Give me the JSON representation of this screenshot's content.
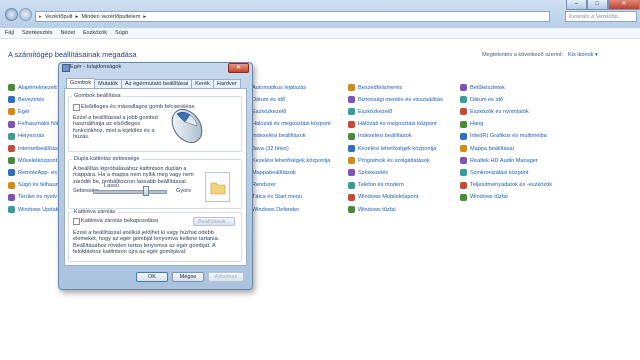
{
  "address": {
    "crumbs": [
      "Vezérlőpult",
      "Minden vezérlőpultelem"
    ],
    "search_placeholder": "Keresés a Vezérlőp..."
  },
  "window_controls": [
    "–",
    "□",
    "✕"
  ],
  "menu": [
    "Fájl",
    "Szerkesztés",
    "Nézet",
    "Eszközök",
    "Súgó"
  ],
  "page": {
    "title": "A számítógép beállításainak megadása",
    "view_label": "Megtekintés a következő szerint:",
    "view_value": "Kis ikonok ▾"
  },
  "items": {
    "col1": [
      "Alapértelmezett programok",
      "Bevezetés",
      "Egér",
      "Felhasználói fiókok",
      "Helyesírás",
      "Internetbeállítások",
      "Műveletközpont",
      "RemoteApp- és asztali kapcsolatok",
      "Súgó és felhasználói támogatás",
      "Terület és nyelv",
      "Windows Update"
    ],
    "col2": [
      "Automatikus lejátszás",
      "Dátum és idő",
      "Eszközkezelő",
      "Hálózati és megosztási központ",
      "Indexelési beállítások",
      "Java (32 bites)",
      "Kezelési lehetőségek központja",
      "Mappabeállítások",
      "Rendszer",
      "Tálca és Start menü",
      "Windows Defender"
    ],
    "col3": [
      "Beszédfelismerés",
      "Biztonsági mentés és visszaállítás",
      "Eszközkezelő",
      "Hálózati és megosztási központ",
      "Indexelési beállítások",
      "Kezelési lehetőségek központja",
      "Programok és szolgáltatások",
      "Színkezelés",
      "Telefon és modem",
      "Windows Mobileközpont",
      "Windows tűzfal"
    ],
    "col4": [
      "Betűkészletek",
      "Dátum és idő",
      "Eszközök és nyomtatók",
      "Hang",
      "Intel(R) Grafikus és multimédia",
      "Mappa beállításai",
      "Realtek HD Audio Manager",
      "Szinkronizálási központ",
      "Teljesítményadatok és -eszközök",
      "Windows tűzfal"
    ]
  },
  "icon_colors": [
    "#4b8a3b",
    "#2f6fc4",
    "#d28a1d",
    "#7a56b6",
    "#3b9a9a",
    "#c44b3a"
  ],
  "dialog": {
    "title": "Egér - tulajdonságok",
    "tabs": [
      "Gombok",
      "Mutatók",
      "Az egérmutató beállításai",
      "Kerék",
      "Hardver"
    ],
    "group1": {
      "title": "Gombok beállítása",
      "checkbox_label": "Elsődleges és másodlagos gomb felcserélése",
      "description": "Ezzel a beállítással a jobb gombot használhatja az elsődleges funkciókhoz, mint a kijelölés és a húzás."
    },
    "group2": {
      "title": "Dupla kattintás sebessége",
      "description": "A beállítás kipróbálásához kattintson duplán a mappára. Ha a mappa nem nyílik meg vagy nem záródik be, próbálkozzon lassabb beállítással.",
      "speed_label": "Sebesség:",
      "slow": "Lassú",
      "fast": "Gyors",
      "slider_value": 0.72
    },
    "group3": {
      "title": "Kattintva zárolás",
      "checkbox_label": "Kattintva zárolás bekapcsolása",
      "settings_button": "Beállítások...",
      "description": "Ezzel a beállítással anélkül jelölhet ki vagy húzhat odébb elemeket, hogy az egér gombját lenyomva kellene tartania. Beállításához röviden tartsa lenyomva az egér gombját. A feloldáshoz kattintson újra az egér gombjával."
    },
    "buttons": {
      "ok": "OK",
      "cancel": "Mégse",
      "apply": "Alkalmaz"
    }
  }
}
